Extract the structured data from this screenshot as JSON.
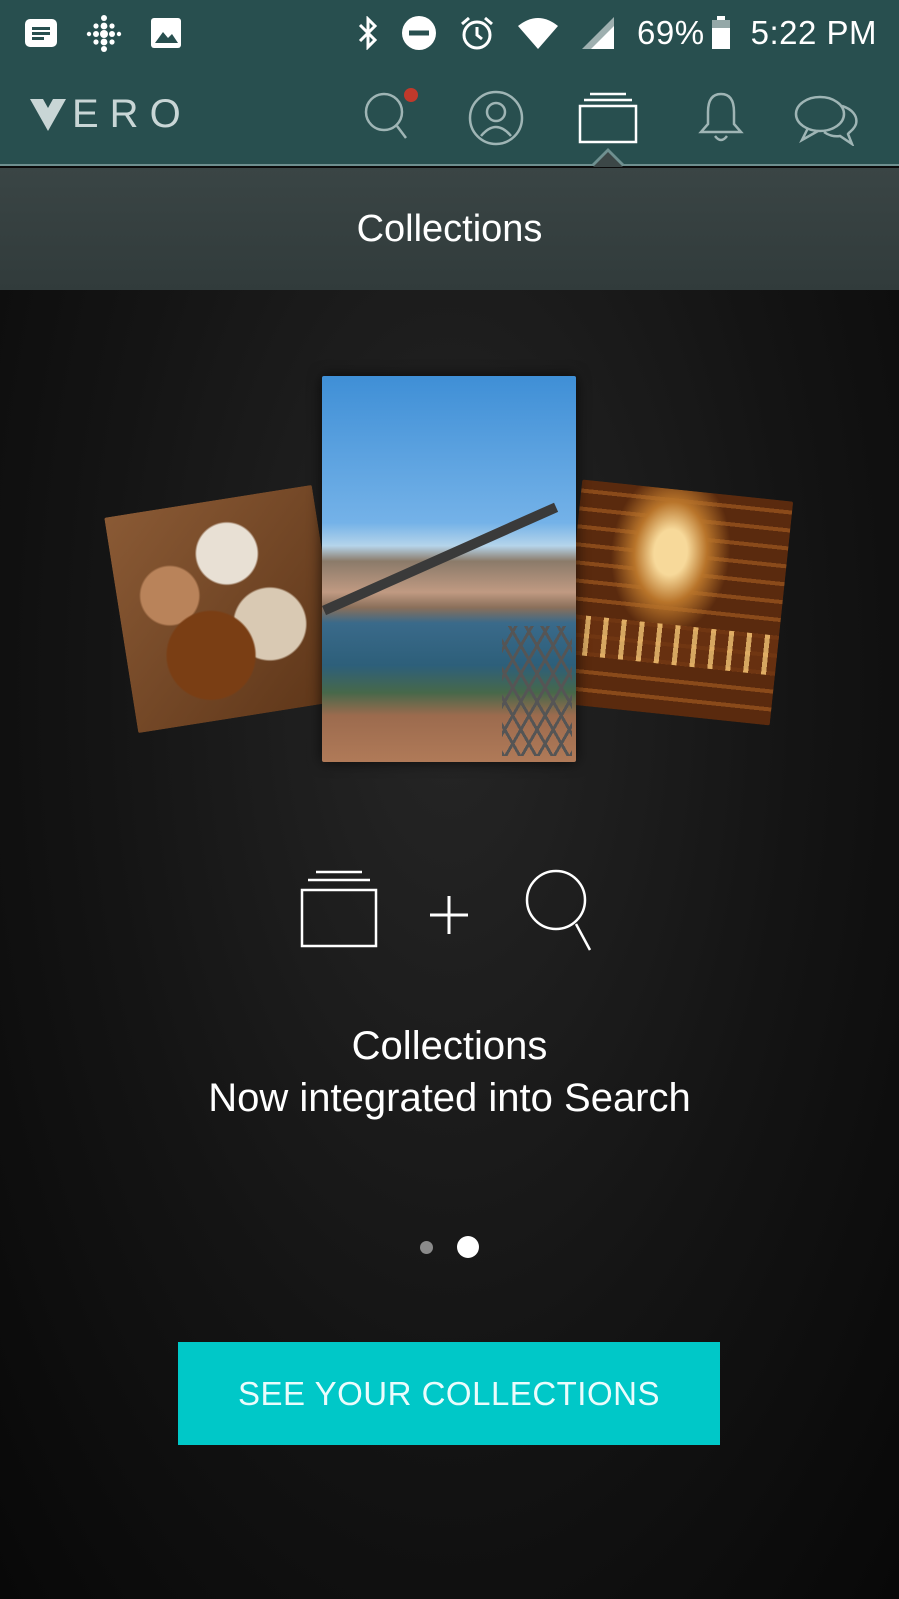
{
  "status_bar": {
    "battery": "69%",
    "time": "5:22 PM",
    "left_icons": [
      "news-icon",
      "fitbit-icon",
      "image-icon"
    ],
    "right_icons": [
      "bluetooth-icon",
      "do-not-disturb-icon",
      "alarm-icon",
      "wifi-icon",
      "signal-icon",
      "battery-icon"
    ]
  },
  "nav": {
    "logo": "ERO",
    "tabs": [
      "search-icon",
      "profile-icon",
      "collections-icon",
      "notifications-icon",
      "chat-icon"
    ],
    "active_tab": "collections-icon",
    "accent": "#284f4f"
  },
  "header": {
    "title": "Collections"
  },
  "main": {
    "caption_line1": "Collections",
    "caption_line2": "Now integrated into Search",
    "pager_count": 2,
    "pager_active_index": 1,
    "cta_label": "SEE YOUR COLLECTIONS",
    "cta_color": "#00c8c8"
  }
}
